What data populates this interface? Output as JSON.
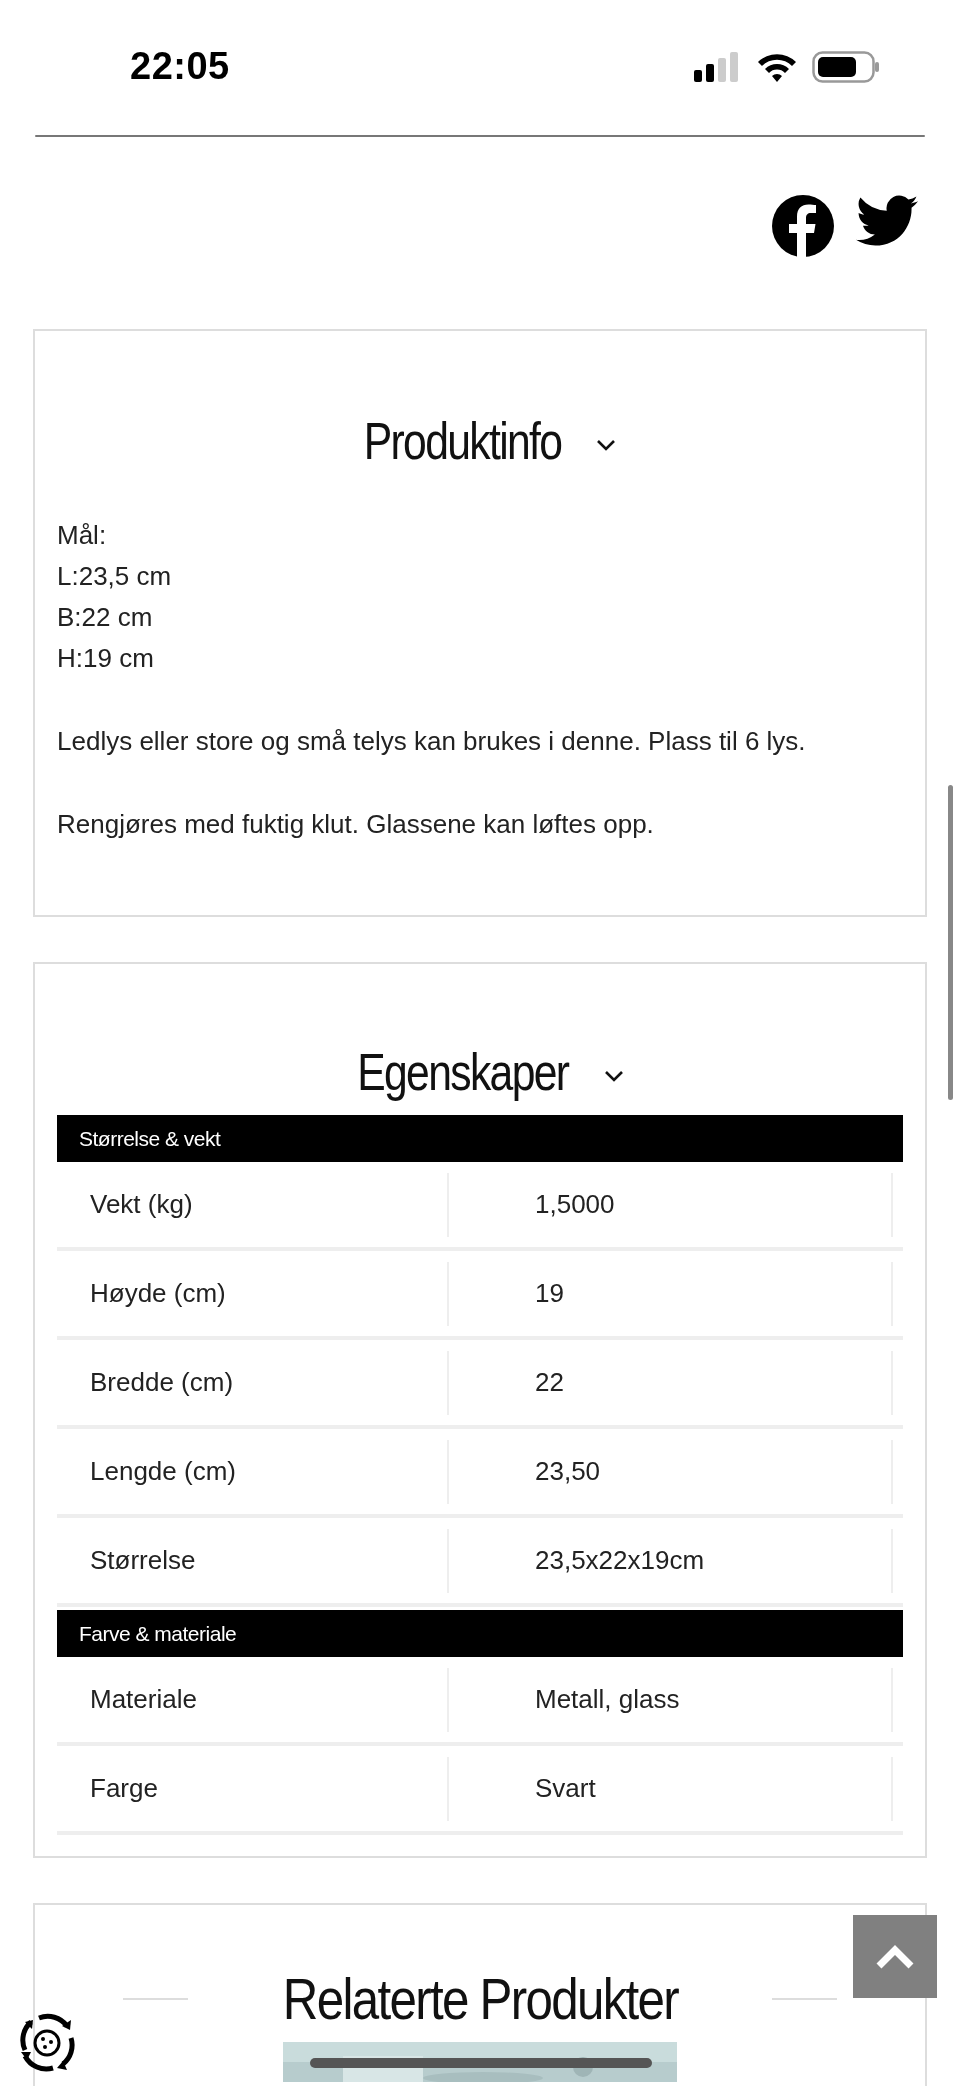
{
  "status_bar": {
    "time": "22:05"
  },
  "product_info": {
    "title": "Produktinfo",
    "expanded": true,
    "lines": [
      "Mål:",
      "L:23,5 cm",
      "B:22 cm",
      "H:19 cm"
    ],
    "paragraphs": [
      "Ledlys eller store og små telys kan brukes i denne. Plass til 6 lys.",
      "Rengjøres med fuktig klut. Glassene kan løftes opp."
    ]
  },
  "properties": {
    "title": "Egenskaper",
    "expanded": true,
    "groups": [
      {
        "heading": "Størrelse & vekt",
        "rows": [
          {
            "label": "Vekt (kg)",
            "value": "1,5000"
          },
          {
            "label": "Høyde (cm)",
            "value": "19"
          },
          {
            "label": "Bredde (cm)",
            "value": "22"
          },
          {
            "label": "Lengde (cm)",
            "value": "23,50"
          },
          {
            "label": "Størrelse",
            "value": "23,5x22x19cm"
          }
        ]
      },
      {
        "heading": "Farve & materiale",
        "rows": [
          {
            "label": "Materiale",
            "value": "Metall, glass"
          },
          {
            "label": "Farge",
            "value": "Svart"
          }
        ]
      }
    ]
  },
  "related": {
    "title": "Relaterte Produkter"
  }
}
